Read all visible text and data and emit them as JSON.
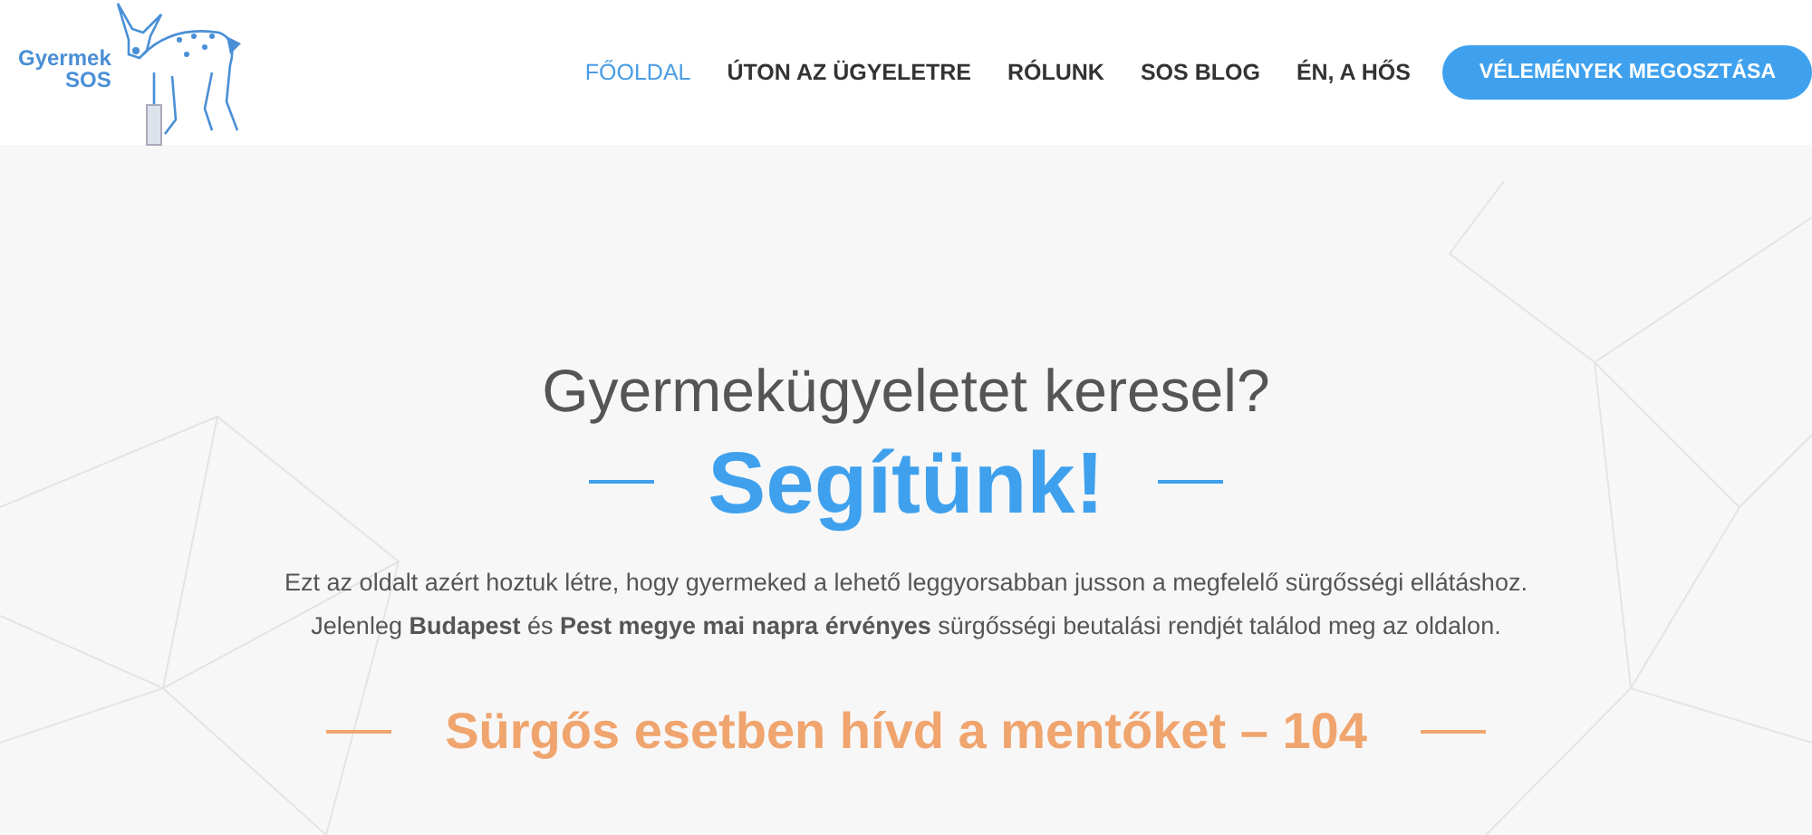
{
  "logo": {
    "line_1": "Gyermek",
    "line_2": "SOS"
  },
  "nav": [
    {
      "label": "FŐOLDAL",
      "selected": true
    },
    {
      "label": "ÚTON AZ ÜGYELETRE",
      "selected": false
    },
    {
      "label": "RÓLUNK",
      "selected": false
    },
    {
      "label": "SOS BLOG",
      "selected": false
    },
    {
      "label": "ÉN, A HŐS",
      "selected": false
    }
  ],
  "cta_button": "VÉLEMÉNYEK MEGOSZTÁSA",
  "hero": {
    "question": "Gyermekügyeletet keresel?",
    "headline": "Segítünk!",
    "paragraph_1": "Ezt az oldalt azért hoztuk létre, hogy gyermeked a lehető leggyorsabban jusson a megfelelő sürgősségi ellátáshoz.",
    "paragraph_2": "Jelenleg **Budapest** és **Pest megye mai napra érvényes** sürgősségi beutalási rendjét találod meg az oldalon.",
    "emergency": "Sürgős esetben hívd a mentőket – 104"
  }
}
